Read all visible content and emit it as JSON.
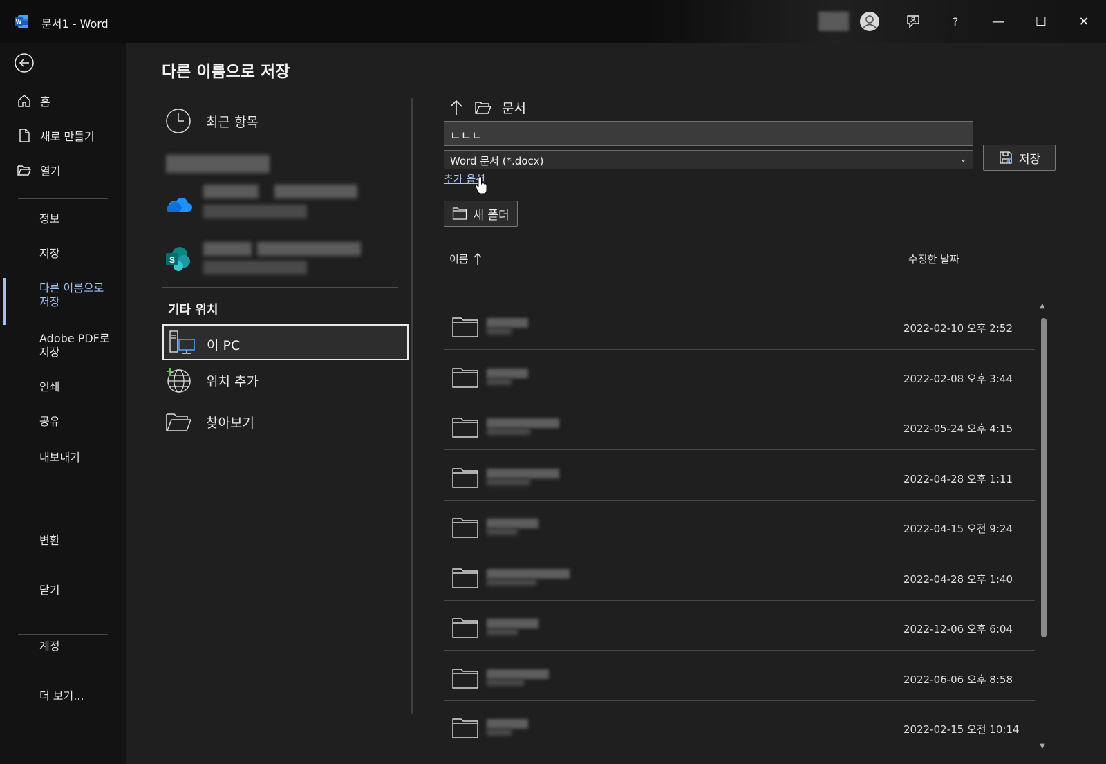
{
  "window": {
    "title": "문서1  -  Word",
    "controls": {
      "account": "account-icon",
      "feedback": "feedback-icon",
      "help": "?",
      "minimize": "—",
      "maximize": "☐",
      "close": "✕"
    }
  },
  "sidebar": {
    "top_items": [
      {
        "label": "홈",
        "icon": "home-icon"
      },
      {
        "label": "새로 만들기",
        "icon": "new-document-icon"
      },
      {
        "label": "열기",
        "icon": "open-folder-icon"
      }
    ],
    "items": [
      {
        "label": "정보"
      },
      {
        "label": "저장"
      },
      {
        "label": "다른 이름으로 저장",
        "active": true
      },
      {
        "label": "Adobe PDF로 저장"
      },
      {
        "label": "인쇄"
      },
      {
        "label": "공유"
      },
      {
        "label": "내보내기"
      },
      {
        "label": "변환"
      },
      {
        "label": "닫기"
      },
      {
        "label": "계정"
      },
      {
        "label": "더 보기..."
      }
    ]
  },
  "page": {
    "title": "다른 이름으로 저장",
    "locations": {
      "recent": "최근 항목",
      "other_title": "기타 위치",
      "this_pc": "이 PC",
      "add_place": "위치 추가",
      "browse": "찾아보기"
    },
    "save_panel": {
      "path": "문서",
      "filename": "ㄴㄴㄴ",
      "filetype": "Word 문서 (*.docx)",
      "save_label": "저장",
      "more_options": "추가 옵션",
      "new_folder": "새 폴더",
      "col_name": "이름",
      "col_date": "수정한 날짜"
    },
    "files": [
      {
        "date": "2022-02-10 오후 2:52"
      },
      {
        "date": "2022-02-08 오후 3:44"
      },
      {
        "date": "2022-05-24 오후 4:15"
      },
      {
        "date": "2022-04-28 오후 1:11"
      },
      {
        "date": "2022-04-15 오전 9:24"
      },
      {
        "date": "2022-04-28 오후 1:40"
      },
      {
        "date": "2022-12-06 오후 6:04"
      },
      {
        "date": "2022-06-06 오후 8:58"
      },
      {
        "date": "2022-02-15 오전 10:14"
      }
    ]
  },
  "colors": {
    "accent": "#9ec0f0",
    "link": "#a8c6f0",
    "background": "#1f1f1f",
    "sidebar": "#131313"
  }
}
